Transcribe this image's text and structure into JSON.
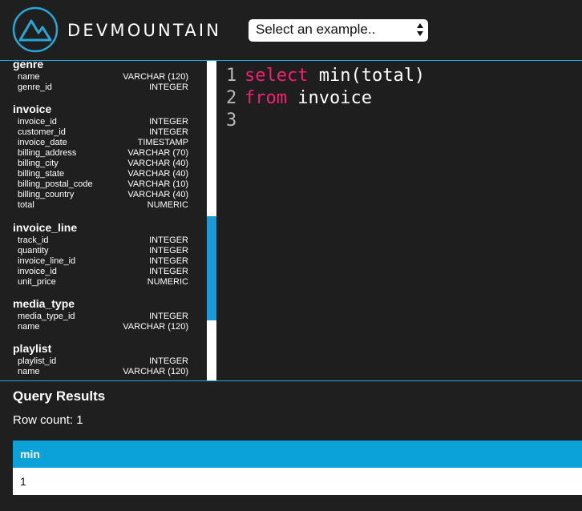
{
  "brand": {
    "name": "DEVMOUNTAIN"
  },
  "example_select": {
    "value": "Select an example.."
  },
  "schema": [
    {
      "title": "genre",
      "columns": [
        {
          "name": "name",
          "type": "VARCHAR (120)"
        },
        {
          "name": "genre_id",
          "type": "INTEGER"
        }
      ]
    },
    {
      "title": "invoice",
      "columns": [
        {
          "name": "invoice_id",
          "type": "INTEGER"
        },
        {
          "name": "customer_id",
          "type": "INTEGER"
        },
        {
          "name": "invoice_date",
          "type": "TIMESTAMP"
        },
        {
          "name": "billing_address",
          "type": "VARCHAR (70)"
        },
        {
          "name": "billing_city",
          "type": "VARCHAR (40)"
        },
        {
          "name": "billing_state",
          "type": "VARCHAR (40)"
        },
        {
          "name": "billing_postal_code",
          "type": "VARCHAR (10)"
        },
        {
          "name": "billing_country",
          "type": "VARCHAR (40)"
        },
        {
          "name": "total",
          "type": "NUMERIC"
        }
      ]
    },
    {
      "title": "invoice_line",
      "columns": [
        {
          "name": "track_id",
          "type": "INTEGER"
        },
        {
          "name": "quantity",
          "type": "INTEGER"
        },
        {
          "name": "invoice_line_id",
          "type": "INTEGER"
        },
        {
          "name": "invoice_id",
          "type": "INTEGER"
        },
        {
          "name": "unit_price",
          "type": "NUMERIC"
        }
      ]
    },
    {
      "title": "media_type",
      "columns": [
        {
          "name": "media_type_id",
          "type": "INTEGER"
        },
        {
          "name": "name",
          "type": "VARCHAR (120)"
        }
      ]
    },
    {
      "title": "playlist",
      "columns": [
        {
          "name": "playlist_id",
          "type": "INTEGER"
        },
        {
          "name": "name",
          "type": "VARCHAR (120)"
        }
      ]
    }
  ],
  "editor": {
    "lines": [
      {
        "number": "1",
        "keyword": "select",
        "rest": " min(total)"
      },
      {
        "number": "2",
        "keyword": "from",
        "rest": " invoice"
      },
      {
        "number": "3",
        "keyword": "",
        "rest": ""
      }
    ]
  },
  "results": {
    "title": "Query Results",
    "row_count": "Row count: 1",
    "columns": [
      "min"
    ],
    "rows": [
      [
        "1"
      ]
    ]
  },
  "colors": {
    "accent": "#0aa2d8",
    "keyword": "#f0206e",
    "background": "#1f1f1f"
  },
  "icons": {
    "logo": "mountain-logo-icon",
    "select_arrows": "updown-arrows-icon"
  }
}
